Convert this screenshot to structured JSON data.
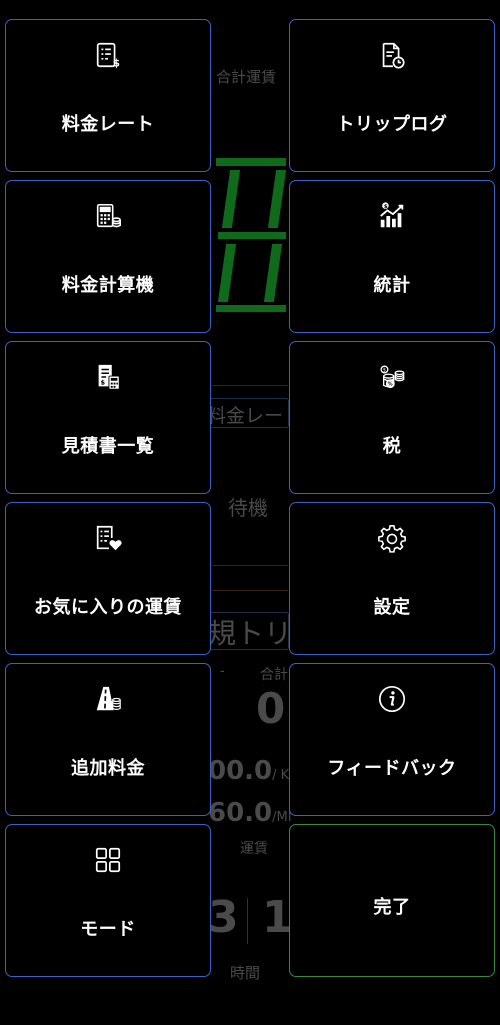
{
  "menu": {
    "items": [
      {
        "label": "料金レート",
        "icon": "rate-sheet-icon"
      },
      {
        "label": "トリップログ",
        "icon": "trip-log-icon"
      },
      {
        "label": "料金計算機",
        "icon": "calculator-icon"
      },
      {
        "label": "統計",
        "icon": "statistics-icon"
      },
      {
        "label": "見積書一覧",
        "icon": "estimate-list-icon"
      },
      {
        "label": "税",
        "icon": "tax-icon"
      },
      {
        "label": "お気に入りの運賃",
        "icon": "favorite-fares-icon"
      },
      {
        "label": "設定",
        "icon": "gear-icon"
      },
      {
        "label": "追加料金",
        "icon": "road-toll-icon"
      },
      {
        "label": "フィードバック",
        "icon": "info-icon"
      },
      {
        "label": "モード",
        "icon": "grid-icon"
      },
      {
        "label": "完了",
        "icon": ""
      }
    ]
  },
  "background": {
    "total_fare_label": "合計運賃",
    "rate_label": "料金レー",
    "status": "待機",
    "trip_label": "規トリ",
    "dash": "-",
    "total_label_small": "合計",
    "total_value": "0",
    "per_km": "00.0",
    "per_km_unit": "/ KI",
    "per_mi": "60.0",
    "per_mi_unit": "/MI",
    "fare_label": "運賃",
    "time_left": "3",
    "time_right": "1",
    "time_label": "時間"
  }
}
